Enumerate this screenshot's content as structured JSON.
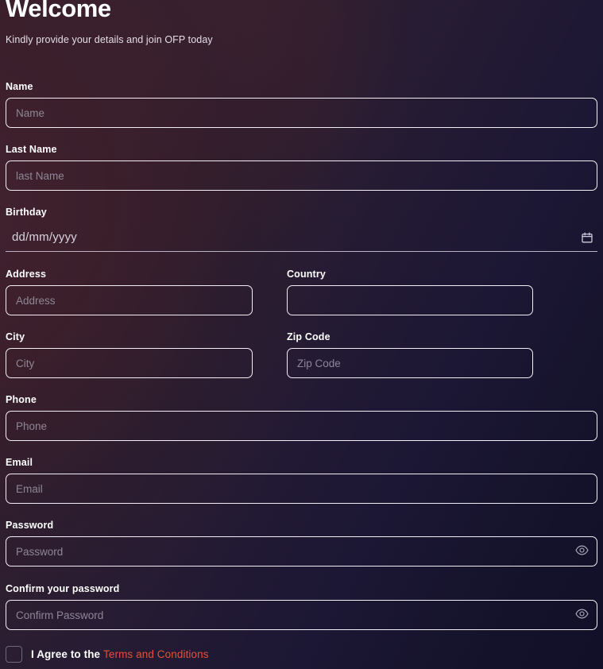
{
  "header": {
    "title": "Welcome",
    "subtitle": "Kindly provide your details and join OFP today"
  },
  "colors": {
    "accent_link": "#e2503c",
    "border": "#f3eef5",
    "placeholder": "#8d8796",
    "bg_maroon": "#3b1f2b",
    "bg_navy": "#14122a"
  },
  "fields": {
    "name": {
      "label": "Name",
      "placeholder": "Name",
      "value": ""
    },
    "last_name": {
      "label": "Last Name",
      "placeholder": "last Name",
      "value": ""
    },
    "birthday": {
      "label": "Birthday",
      "value": "dd/mm/yyyy",
      "icon": "calendar-icon"
    },
    "address": {
      "label": "Address",
      "placeholder": "Address",
      "value": ""
    },
    "country": {
      "label": "Country",
      "placeholder": "",
      "value": ""
    },
    "city": {
      "label": "City",
      "placeholder": "City",
      "value": ""
    },
    "zip_code": {
      "label": "Zip Code",
      "placeholder": "Zip Code",
      "value": ""
    },
    "phone": {
      "label": "Phone",
      "placeholder": "Phone",
      "value": ""
    },
    "email": {
      "label": "Email",
      "placeholder": "Email",
      "value": ""
    },
    "password": {
      "label": "Password",
      "placeholder": "Password",
      "value": "",
      "icon": "eye-icon"
    },
    "confirm_password": {
      "label": "Confirm your password",
      "placeholder": "Confirm Password",
      "value": "",
      "icon": "eye-icon"
    }
  },
  "agreement": {
    "checked": false,
    "text": "I Agree to the",
    "link_text": "Terms and Conditions"
  }
}
